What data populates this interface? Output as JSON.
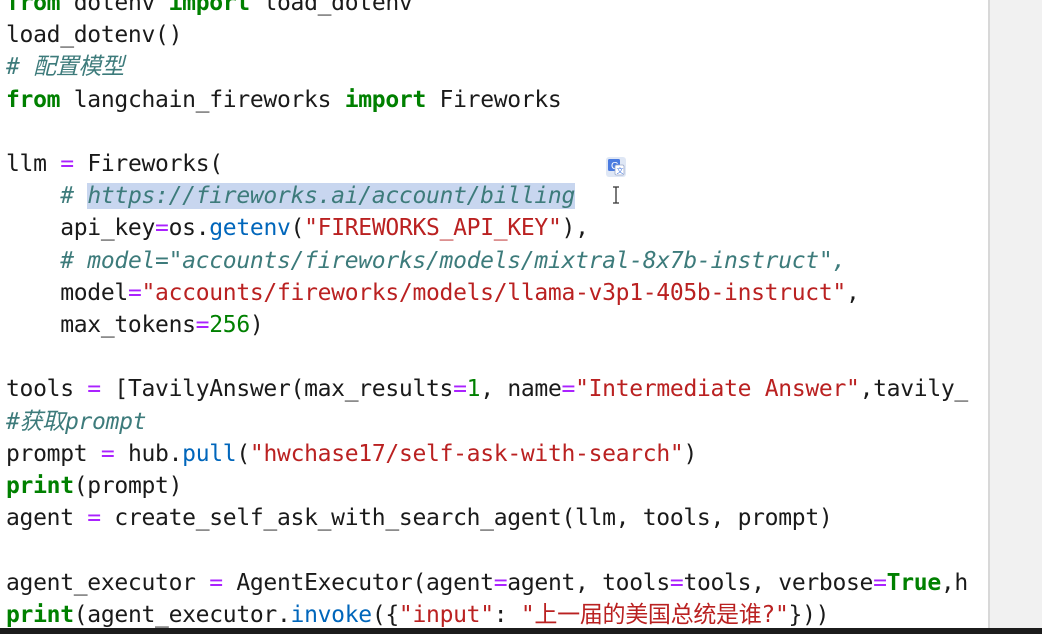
{
  "code_lines": [
    [
      [
        "kw",
        "from"
      ],
      [
        "pl",
        " dotenv "
      ],
      [
        "kw",
        "import"
      ],
      [
        "pl",
        " load_dotenv"
      ]
    ],
    [
      [
        "pl",
        "load_dotenv()"
      ]
    ],
    [
      [
        "cm",
        "# 配置模型"
      ]
    ],
    [
      [
        "kw",
        "from"
      ],
      [
        "pl",
        " langchain_fireworks "
      ],
      [
        "kw",
        "import"
      ],
      [
        "pl",
        " Fireworks"
      ]
    ],
    [],
    [
      [
        "pl",
        "llm "
      ],
      [
        "op",
        "="
      ],
      [
        "pl",
        " Fireworks("
      ]
    ],
    [
      [
        "pl",
        "    "
      ],
      [
        "cm",
        "# "
      ],
      [
        "sel",
        "https://fireworks.ai/account/billing"
      ]
    ],
    [
      [
        "pl",
        "    api_key"
      ],
      [
        "op",
        "="
      ],
      [
        "pl",
        "os."
      ],
      [
        "fn",
        "getenv"
      ],
      [
        "pl",
        "("
      ],
      [
        "st",
        "\"FIREWORKS_API_KEY\""
      ],
      [
        "pl",
        "),"
      ]
    ],
    [
      [
        "pl",
        "    "
      ],
      [
        "cm",
        "# model=\"accounts/fireworks/models/mixtral-8x7b-instruct\","
      ]
    ],
    [
      [
        "pl",
        "    model"
      ],
      [
        "op",
        "="
      ],
      [
        "st",
        "\"accounts/fireworks/models/llama-v3p1-405b-instruct\""
      ],
      [
        "pl",
        ","
      ]
    ],
    [
      [
        "pl",
        "    max_tokens"
      ],
      [
        "op",
        "="
      ],
      [
        "nu",
        "256"
      ],
      [
        "pl",
        ")"
      ]
    ],
    [],
    [
      [
        "pl",
        "tools "
      ],
      [
        "op",
        "="
      ],
      [
        "pl",
        " [TavilyAnswer(max_results"
      ],
      [
        "op",
        "="
      ],
      [
        "nu",
        "1"
      ],
      [
        "pl",
        ", name"
      ],
      [
        "op",
        "="
      ],
      [
        "st",
        "\"Intermediate Answer\""
      ],
      [
        "pl",
        ",tavily_"
      ]
    ],
    [
      [
        "cm",
        "#获取prompt"
      ]
    ],
    [
      [
        "pl",
        "prompt "
      ],
      [
        "op",
        "="
      ],
      [
        "pl",
        " hub."
      ],
      [
        "fn",
        "pull"
      ],
      [
        "pl",
        "("
      ],
      [
        "st",
        "\"hwchase17/self-ask-with-search\""
      ],
      [
        "pl",
        ")"
      ]
    ],
    [
      [
        "kw",
        "print"
      ],
      [
        "pl",
        "(prompt)"
      ]
    ],
    [
      [
        "pl",
        "agent "
      ],
      [
        "op",
        "="
      ],
      [
        "pl",
        " create_self_ask_with_search_agent(llm, tools, prompt)"
      ]
    ],
    [],
    [
      [
        "pl",
        "agent_executor "
      ],
      [
        "op",
        "="
      ],
      [
        "pl",
        " AgentExecutor(agent"
      ],
      [
        "op",
        "="
      ],
      [
        "pl",
        "agent, tools"
      ],
      [
        "op",
        "="
      ],
      [
        "pl",
        "tools, verbose"
      ],
      [
        "op",
        "="
      ],
      [
        "kw",
        "True"
      ],
      [
        "pl",
        ",h"
      ]
    ],
    [
      [
        "kw",
        "print"
      ],
      [
        "pl",
        "(agent_executor."
      ],
      [
        "fn",
        "invoke"
      ],
      [
        "pl",
        "({"
      ],
      [
        "st",
        "\"input\""
      ],
      [
        "pl",
        ": "
      ],
      [
        "st",
        "\"上一届的美国总统是谁?\""
      ],
      [
        "pl",
        "}))"
      ]
    ]
  ],
  "icons": {
    "translate": "translate-icon",
    "cursor": "text-cursor-icon"
  }
}
